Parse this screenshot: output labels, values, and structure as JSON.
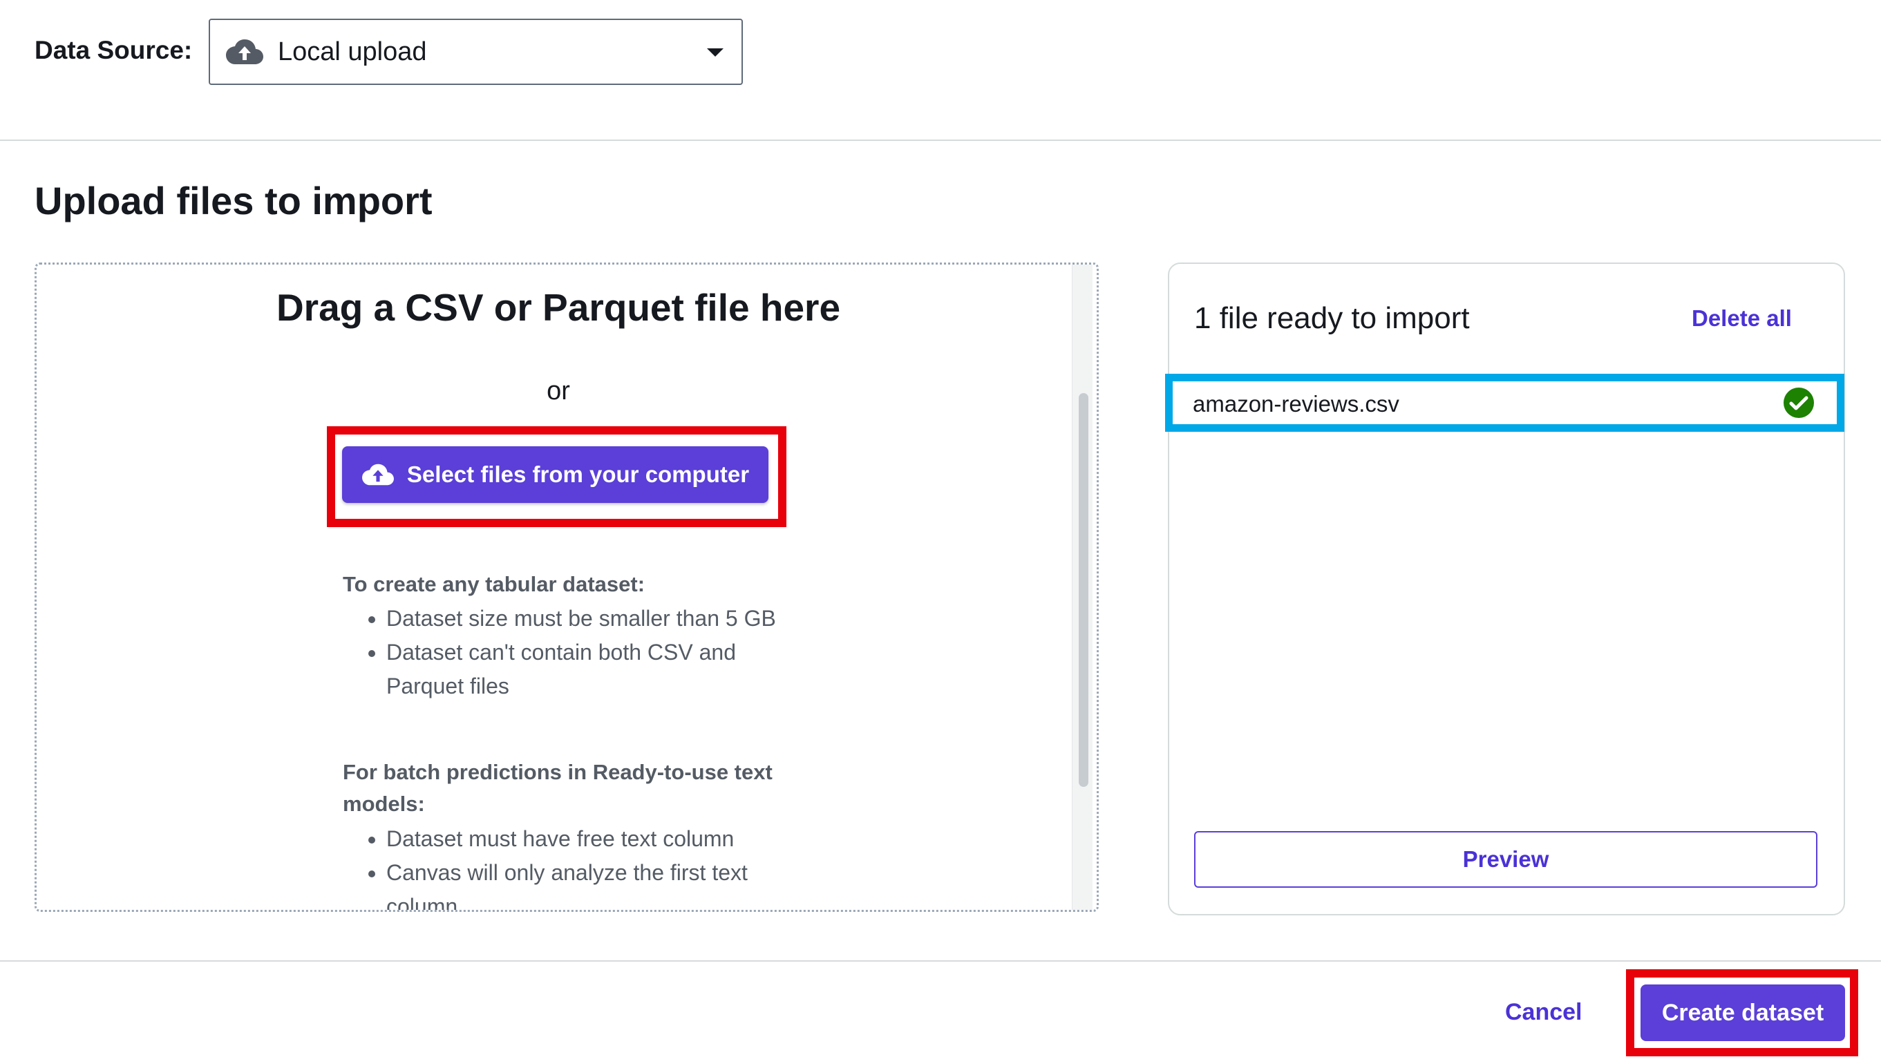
{
  "data_source": {
    "label": "Data Source:",
    "selected": "Local upload",
    "icon": "cloud-upload-icon"
  },
  "page_title": "Upload files to import",
  "dropzone": {
    "heading": "Drag a CSV or Parquet file here",
    "or_text": "or",
    "select_button": "Select files from your computer",
    "tabular_heading": "To create any tabular dataset:",
    "tabular_items": [
      "Dataset size must be smaller than 5 GB",
      "Dataset can't contain both CSV and Parquet files"
    ],
    "batch_heading": "For batch predictions in Ready-to-use text models:",
    "batch_items": [
      "Dataset must have free text column",
      "Canvas will only analyze the first text column"
    ]
  },
  "import_panel": {
    "title": "1 file ready to import",
    "delete_all": "Delete all",
    "files": [
      {
        "name": "amazon-reviews.csv",
        "status": "ready"
      }
    ],
    "preview_button": "Preview"
  },
  "footer": {
    "cancel": "Cancel",
    "create": "Create dataset"
  },
  "colors": {
    "primary": "#5b3fd8",
    "link": "#4a32d6",
    "highlight_red": "#e8000b",
    "highlight_blue": "#00a8e8",
    "success": "#1d8102"
  }
}
